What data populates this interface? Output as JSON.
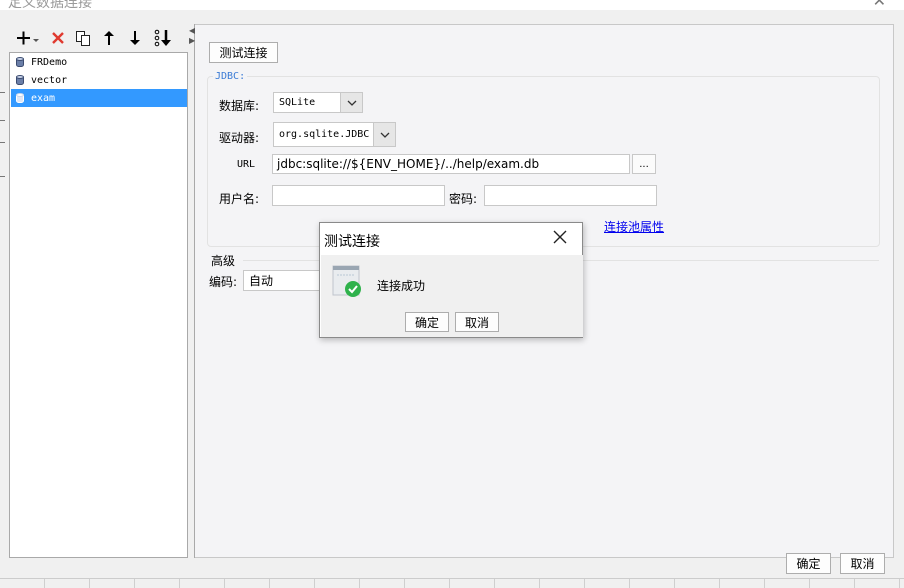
{
  "window": {
    "title": "定义数据连接"
  },
  "toolbar": {
    "icons": [
      "add-dropdown-icon",
      "delete-icon",
      "copy-icon",
      "move-up-icon",
      "move-down-icon",
      "sort-icon"
    ]
  },
  "connections": [
    {
      "name": "FRDemo",
      "selected": false
    },
    {
      "name": "vector",
      "selected": false
    },
    {
      "name": "exam",
      "selected": true
    }
  ],
  "form": {
    "test_button": "测试连接",
    "jdbc_legend": "JDBC:",
    "database_label": "数据库:",
    "database_value": "SQLite",
    "driver_label": "驱动器:",
    "driver_value": "org.sqlite.JDBC",
    "url_label": "URL",
    "url_value": "jdbc:sqlite://${ENV_HOME}/../help/exam.db",
    "url_browse": "...",
    "username_label": "用户名:",
    "username_value": "",
    "password_label": "密码:",
    "password_value": "",
    "pool_link": "连接池属性",
    "advanced_title": "高级",
    "encoding_label": "编码:",
    "encoding_value": "自动"
  },
  "footer": {
    "ok": "确定",
    "cancel": "取消"
  },
  "modal": {
    "title": "测试连接",
    "message": "连接成功",
    "ok": "确定",
    "cancel": "取消",
    "icon": "success-check-icon",
    "success_color": "#2fb24c"
  },
  "colors": {
    "selection": "#3399ff",
    "link": "#0000ee",
    "jdbc_legend": "#3a7bd5",
    "delete": "#e03a2f"
  }
}
